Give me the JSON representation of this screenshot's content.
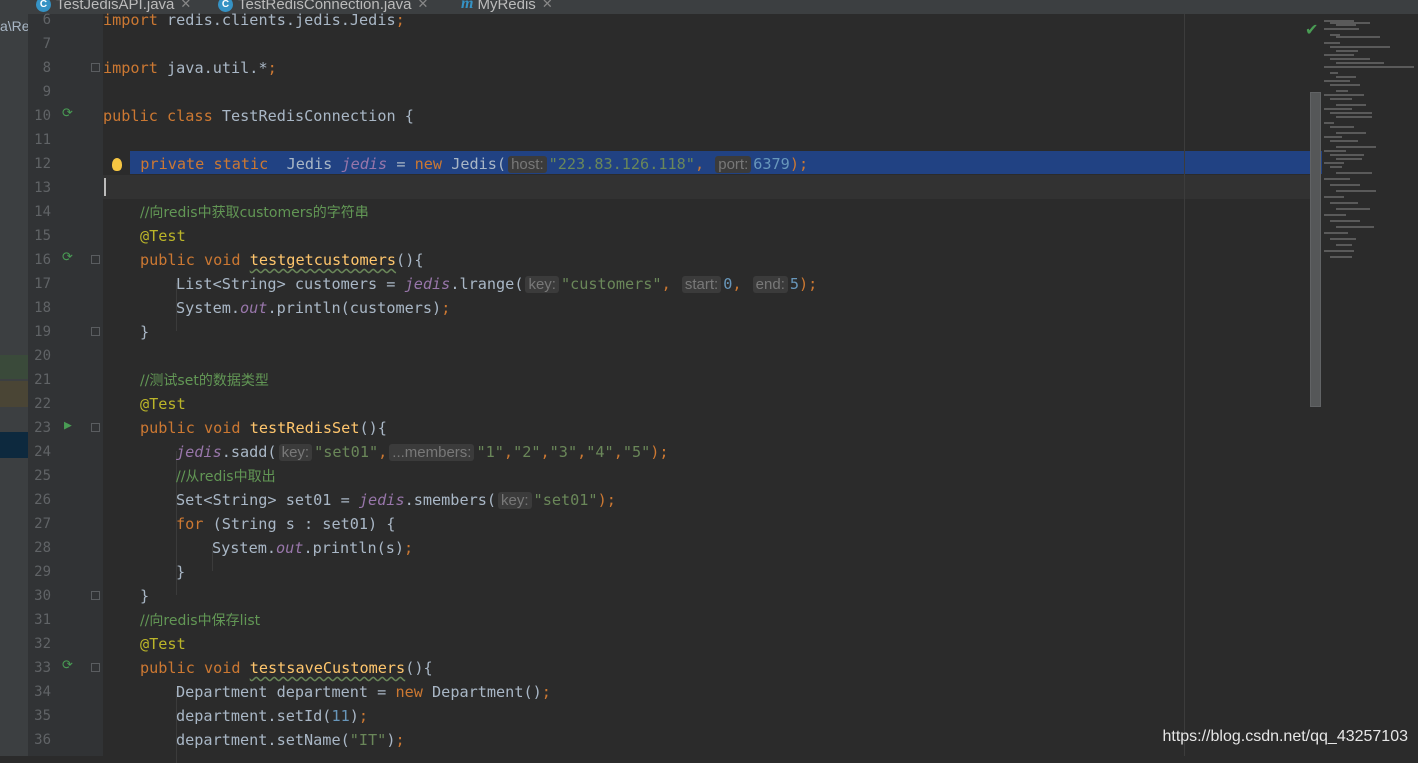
{
  "tabs": [
    {
      "label": "TestJedisAPI.java",
      "icon": "class-icon"
    },
    {
      "label": "TestRedisConnection.java",
      "icon": "class-icon",
      "active": true
    },
    {
      "label": "MyRedis",
      "icon": "interface-icon"
    }
  ],
  "breadcrumb": "a\\Re",
  "line_numbers": [
    "6",
    "7",
    "8",
    "9",
    "10",
    "11",
    "12",
    "13",
    "14",
    "15",
    "16",
    "17",
    "18",
    "19",
    "20",
    "21",
    "22",
    "23",
    "24",
    "25",
    "26",
    "27",
    "28",
    "29",
    "30",
    "31",
    "32",
    "33",
    "34",
    "35",
    "36"
  ],
  "code": {
    "l6a": "import ",
    "l6b": "redis.clients.jedis.Jedis",
    "l6c": ";",
    "l8a": "import ",
    "l8b": "java.util.*",
    "l8c": ";",
    "l10a": "public class ",
    "l10b": "TestRedisConnection {",
    "l12a": "private static  ",
    "l12b": "Jedis ",
    "l12c": "jedis",
    "l12d": " = ",
    "l12e": "new ",
    "l12f": "Jedis(",
    "l12hint1": "host:",
    "l12s1": "\"223.83.126.118\"",
    "l12comma": ", ",
    "l12hint2": "port:",
    "l12n": "6379",
    "l12end": ");",
    "l14": "//向redis中获取customers的字符串",
    "l15": "@Test",
    "l16a": "public void ",
    "l16b": "testgetcustomers",
    "l16c": "(){",
    "l17a": "List<String> customers = ",
    "l17b": "jedis",
    "l17c": ".lrange(",
    "l17h1": "key:",
    "l17s": "\"customers\"",
    "l17c2": ", ",
    "l17h2": "start:",
    "l17n1": "0",
    "l17c3": ", ",
    "l17h3": "end:",
    "l17n2": "5",
    "l17end": ");",
    "l18a": "System.",
    "l18b": "out",
    "l18c": ".println(customers)",
    "l18d": ";",
    "l19": "}",
    "l21": "//测试set的数据类型",
    "l22": "@Test",
    "l23a": "public void ",
    "l23b": "testRedisSet",
    "l23c": "(){",
    "l24a": "jedis",
    "l24b": ".sadd(",
    "l24h1": "key:",
    "l24s1": "\"set01\"",
    "l24c1": ",",
    "l24h2": "...members:",
    "l24s2": "\"1\"",
    "l24s3": "\"2\"",
    "l24s4": "\"3\"",
    "l24s5": "\"4\"",
    "l24s6": "\"5\"",
    "l24end": ");",
    "l25": "//从redis中取出",
    "l26a": "Set<String> set01 = ",
    "l26b": "jedis",
    "l26c": ".smembers(",
    "l26h": "key:",
    "l26s": "\"set01\"",
    "l26end": ");",
    "l27a": "for ",
    "l27b": "(String s : set01) {",
    "l28a": "System.",
    "l28b": "out",
    "l28c": ".println(s)",
    "l28d": ";",
    "l29": "}",
    "l30": "}",
    "l31": "//向redis中保存list",
    "l32": "@Test",
    "l33a": "public void ",
    "l33b": "testsaveCustomers",
    "l33c": "(){",
    "l34a": "Department department = ",
    "l34b": "new ",
    "l34c": "Department()",
    "l34d": ";",
    "l35a": "department.setId(",
    "l35b": "11",
    "l35c": ")",
    "l35d": ";",
    "l36a": "department.setName(",
    "l36b": "\"IT\"",
    "l36c": ")",
    "l36d": ";"
  },
  "watermark": "https://blog.csdn.net/qq_43257103",
  "colors": {
    "keyword": "#cc7832",
    "string": "#6a8759",
    "number": "#6897bb",
    "field": "#9876aa",
    "comment": "#629755",
    "annotation": "#bbb529",
    "selection": "#214283"
  }
}
